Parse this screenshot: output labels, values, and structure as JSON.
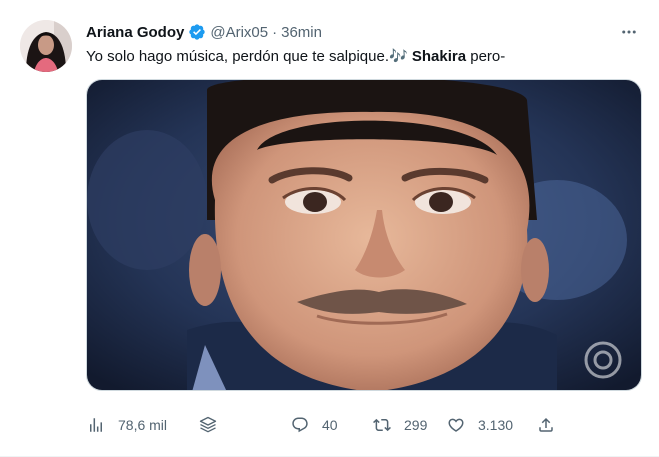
{
  "author": {
    "display_name": "Ariana Godoy",
    "handle": "@Arix05",
    "separator": "·",
    "time": "36min"
  },
  "tweet": {
    "text_before": "Yo solo hago música, perdón que te salpique.",
    "emoji": "🎶",
    "bold_text": "Shakira",
    "text_after": " pero-"
  },
  "metrics": {
    "views": "78,6 mil",
    "replies": "40",
    "retweets": "299",
    "likes": "3.130"
  },
  "colors": {
    "verified_badge": "#1d9bf0",
    "secondary_text": "#536471",
    "primary_text": "#0f1419"
  },
  "icons": {
    "verified": "verified-badge-icon",
    "more": "more-icon",
    "views": "analytics-icon",
    "stack": "stack-icon",
    "reply": "reply-icon",
    "retweet": "retweet-icon",
    "like": "heart-icon",
    "share": "share-icon"
  }
}
